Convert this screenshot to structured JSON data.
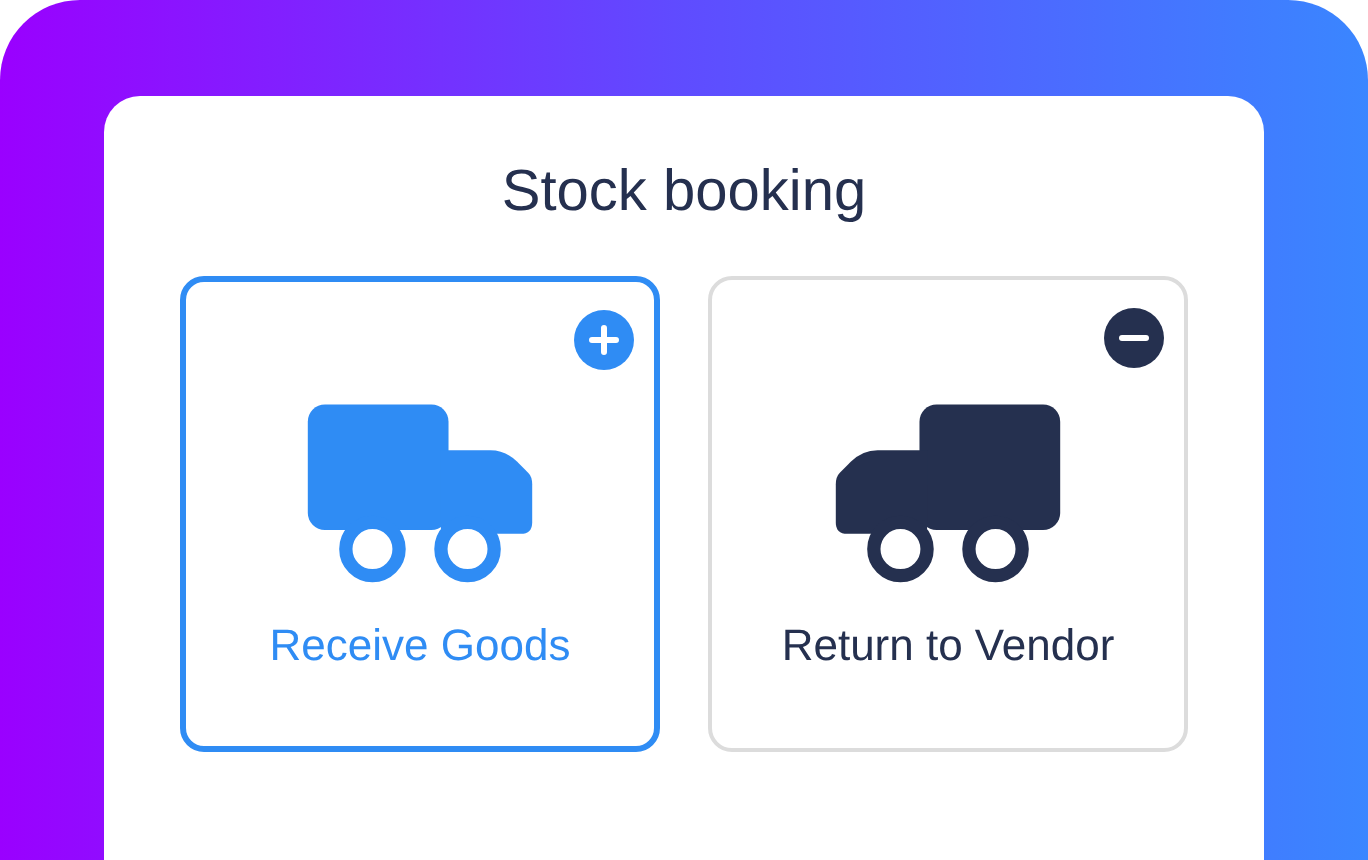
{
  "title": "Stock booking",
  "options": [
    {
      "label": "Receive Goods",
      "kind": "receive",
      "selected": true
    },
    {
      "label": "Return to Vendor",
      "kind": "return",
      "selected": false
    }
  ]
}
